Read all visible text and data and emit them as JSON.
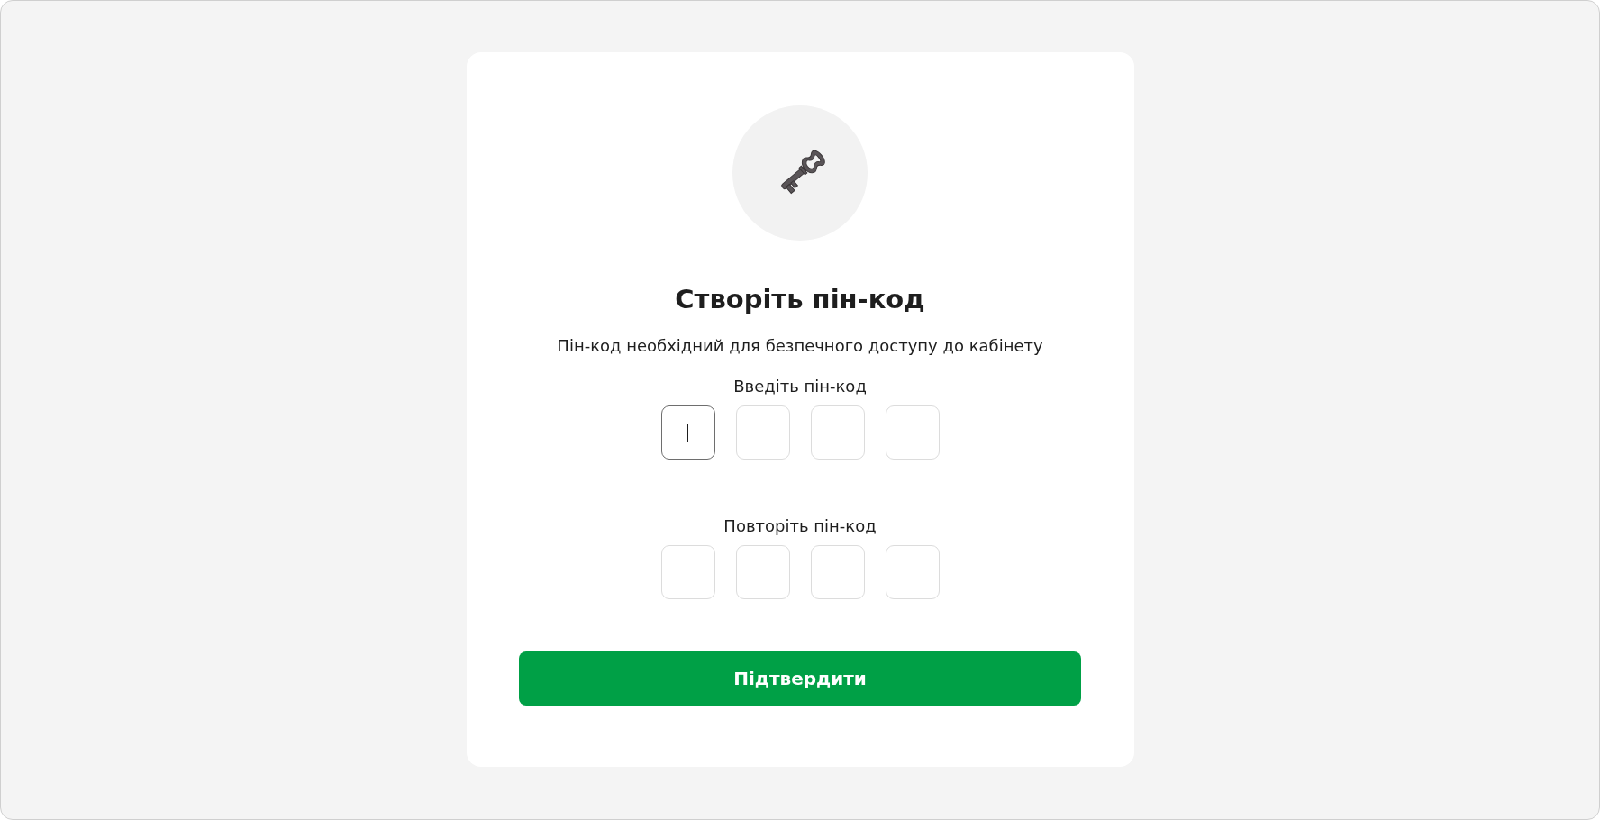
{
  "title": "Створіть пін-код",
  "subtitle": "Пін-код необхідний для безпечного доступу до кабінету",
  "pin_groups": [
    {
      "label": "Введіть пін-код",
      "cells": [
        {
          "focused": true
        },
        {
          "focused": false
        },
        {
          "focused": false
        },
        {
          "focused": false
        }
      ]
    },
    {
      "label": "Повторіть пін-код",
      "cells": [
        {
          "focused": false
        },
        {
          "focused": false
        },
        {
          "focused": false
        },
        {
          "focused": false
        }
      ]
    }
  ],
  "button": "Підтвердити"
}
